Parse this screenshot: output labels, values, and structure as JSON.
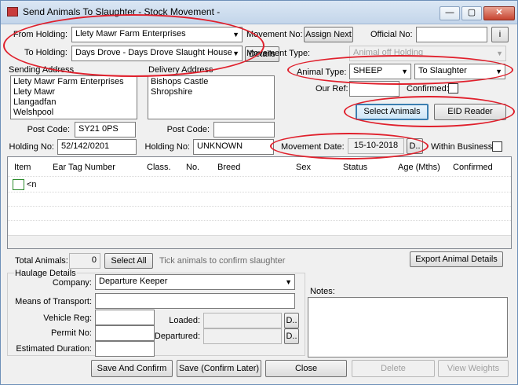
{
  "window": {
    "title": "Send Animals To Slaughter - Stock Movement -",
    "min_glyph": "—",
    "max_glyph": "▢",
    "close_glyph": "✕"
  },
  "movement": {
    "from_holding_label": "From Holding:",
    "from_holding_value": "Llety Mawr Farm Enterprises",
    "to_holding_label": "To Holding:",
    "to_holding_value": "Days Drove - Days Drove Slaught House",
    "details_button": "Details",
    "movement_no_label": "Movement No:",
    "assign_next_button": "Assign Next",
    "official_no_label": "Official No:",
    "official_no_value": "",
    "info_button": "i",
    "movement_type_label": "Movement Type:",
    "movement_type_value": "Animal off Holding",
    "animal_type_label": "Animal Type:",
    "animal_type_value": "SHEEP",
    "destination_value": "To Slaughter",
    "our_ref_label": "Our Ref:",
    "our_ref_value": "",
    "confirmed_label": "Confirmed:",
    "select_animals_button": "Select Animals",
    "eid_reader_button": "EID Reader",
    "movement_date_label": "Movement Date:",
    "movement_date_value": "15-10-2018",
    "date_picker_button": "D..",
    "within_business_label": "Within Business"
  },
  "sending": {
    "label": "Sending Address",
    "lines": [
      "Llety Mawr Farm Enterprises",
      "Llety Mawr",
      "Llangadfan",
      "Welshpool"
    ],
    "post_code_label": "Post Code:",
    "post_code_value": "SY21 0PS",
    "holding_no_label": "Holding No:",
    "holding_no_value": "52/142/0201"
  },
  "delivery": {
    "label": "Delivery Address",
    "lines": [
      "Bishops Castle",
      "Shropshire"
    ],
    "post_code_label": "Post Code:",
    "post_code_value": "",
    "holding_no_label": "Holding No:",
    "holding_no_value": "UNKNOWN"
  },
  "grid": {
    "columns": [
      "Item",
      "Ear Tag Number",
      "Class.",
      "No.",
      "Breed",
      "Sex",
      "Status",
      "Age (Mths)",
      "Confirmed"
    ],
    "new_row_text": "<n"
  },
  "totals": {
    "total_animals_label": "Total Animals:",
    "total_animals_value": "0",
    "select_all_button": "Select All",
    "hint": "Tick animals to confirm slaughter",
    "export_button": "Export Animal Details"
  },
  "haulage": {
    "group_label": "Haulage Details",
    "company_label": "Company:",
    "company_value": "Departure Keeper",
    "means_label": "Means of Transport:",
    "means_value": "",
    "vehicle_reg_label": "Vehicle Reg:",
    "vehicle_reg_value": "",
    "permit_no_label": "Permit No:",
    "permit_no_value": "",
    "duration_label": "Estimated Duration:",
    "duration_value": "",
    "loaded_label": "Loaded:",
    "loaded_value": "",
    "departured_label": "Departured:",
    "departured_value": "",
    "picker_button": "D.."
  },
  "notes": {
    "label": "Notes:",
    "value": ""
  },
  "footer": {
    "save_confirm": "Save And Confirm",
    "save_confirm_later": "Save (Confirm Later)",
    "close": "Close",
    "delete": "Delete",
    "view_weights": "View Weights"
  },
  "colors": {
    "annotation": "#e0202c",
    "title_bar": "#c3d5ea",
    "accent": "#3c7fb1"
  }
}
